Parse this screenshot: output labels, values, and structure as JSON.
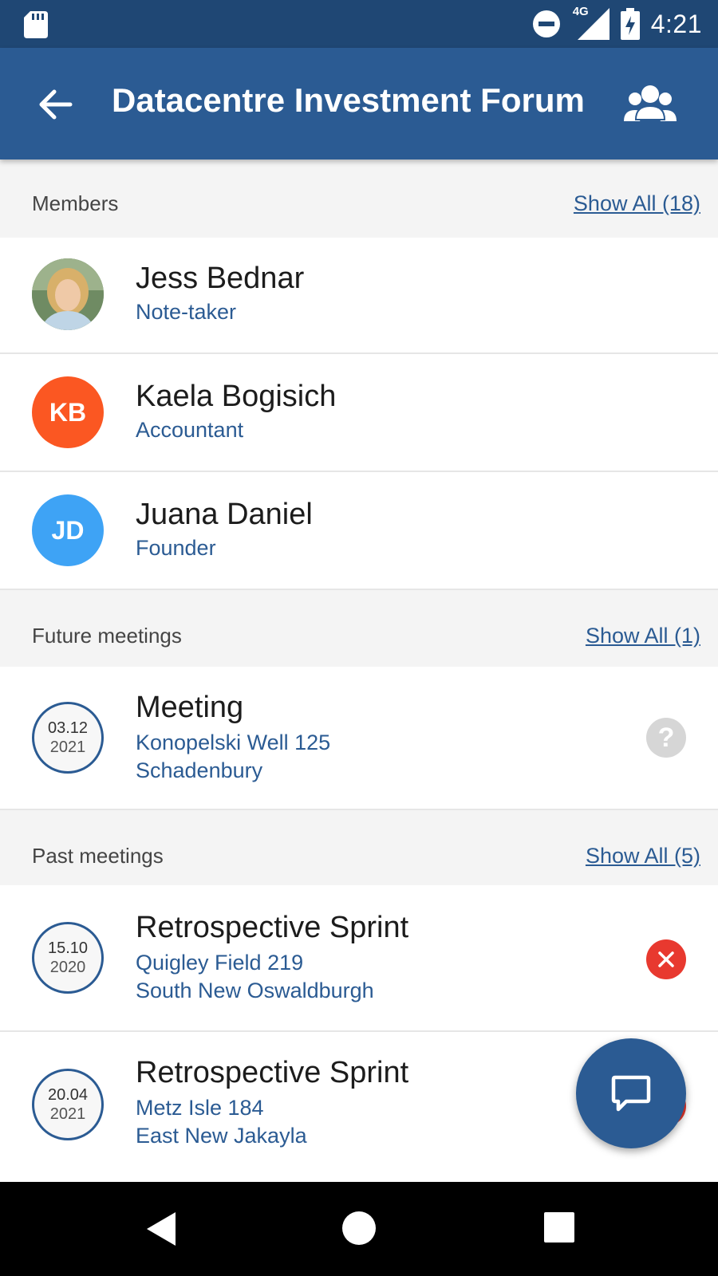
{
  "status_bar": {
    "time": "4:21",
    "network_label": "4G",
    "icons": [
      "sd-card-icon",
      "do-not-disturb-icon",
      "cell-signal-icon",
      "battery-charging-icon"
    ]
  },
  "app_bar": {
    "back_icon": "arrow-back-icon",
    "title": "Datacentre Investment Forum",
    "action_icon": "group-icon"
  },
  "members": {
    "header": "Members",
    "show_all": "Show All (18)",
    "items": [
      {
        "name": "Jess Bednar",
        "role": "Note-taker",
        "avatar_type": "photo"
      },
      {
        "name": "Kaela Bogisich",
        "role": "Accountant",
        "initials": "KB",
        "color": "#fb5722"
      },
      {
        "name": "Juana Daniel",
        "role": "Founder",
        "initials": "JD",
        "color": "#3ea3f5"
      }
    ]
  },
  "future_meetings": {
    "header": "Future meetings",
    "show_all": "Show All (1)",
    "items": [
      {
        "date": "03.12",
        "year": "2021",
        "title": "Meeting",
        "address1": "Konopelski Well 125",
        "address2": "Schadenbury",
        "status_icon": "question-icon",
        "status_color": "#d6d6d6"
      }
    ]
  },
  "past_meetings": {
    "header": "Past meetings",
    "show_all": "Show All (5)",
    "items": [
      {
        "date": "15.10",
        "year": "2020",
        "title": "Retrospective Sprint",
        "address1": "Quigley Field 219",
        "address2": "South New Oswaldburgh",
        "status_icon": "declined-x-icon",
        "status_color": "#e8392f"
      },
      {
        "date": "20.04",
        "year": "2021",
        "title": "Retrospective Sprint",
        "address1": "Metz Isle 184",
        "address2": "East New Jakayla",
        "status_icon": "declined-x-icon",
        "status_color": "#e8392f"
      }
    ]
  },
  "fab": {
    "icon": "chat-icon"
  },
  "nav_bar": {
    "icons": [
      "nav-back-icon",
      "nav-home-icon",
      "nav-recents-icon"
    ]
  },
  "colors": {
    "primary": "#2b5b93",
    "primary_dark": "#1f4774",
    "link": "#2b5b93"
  }
}
